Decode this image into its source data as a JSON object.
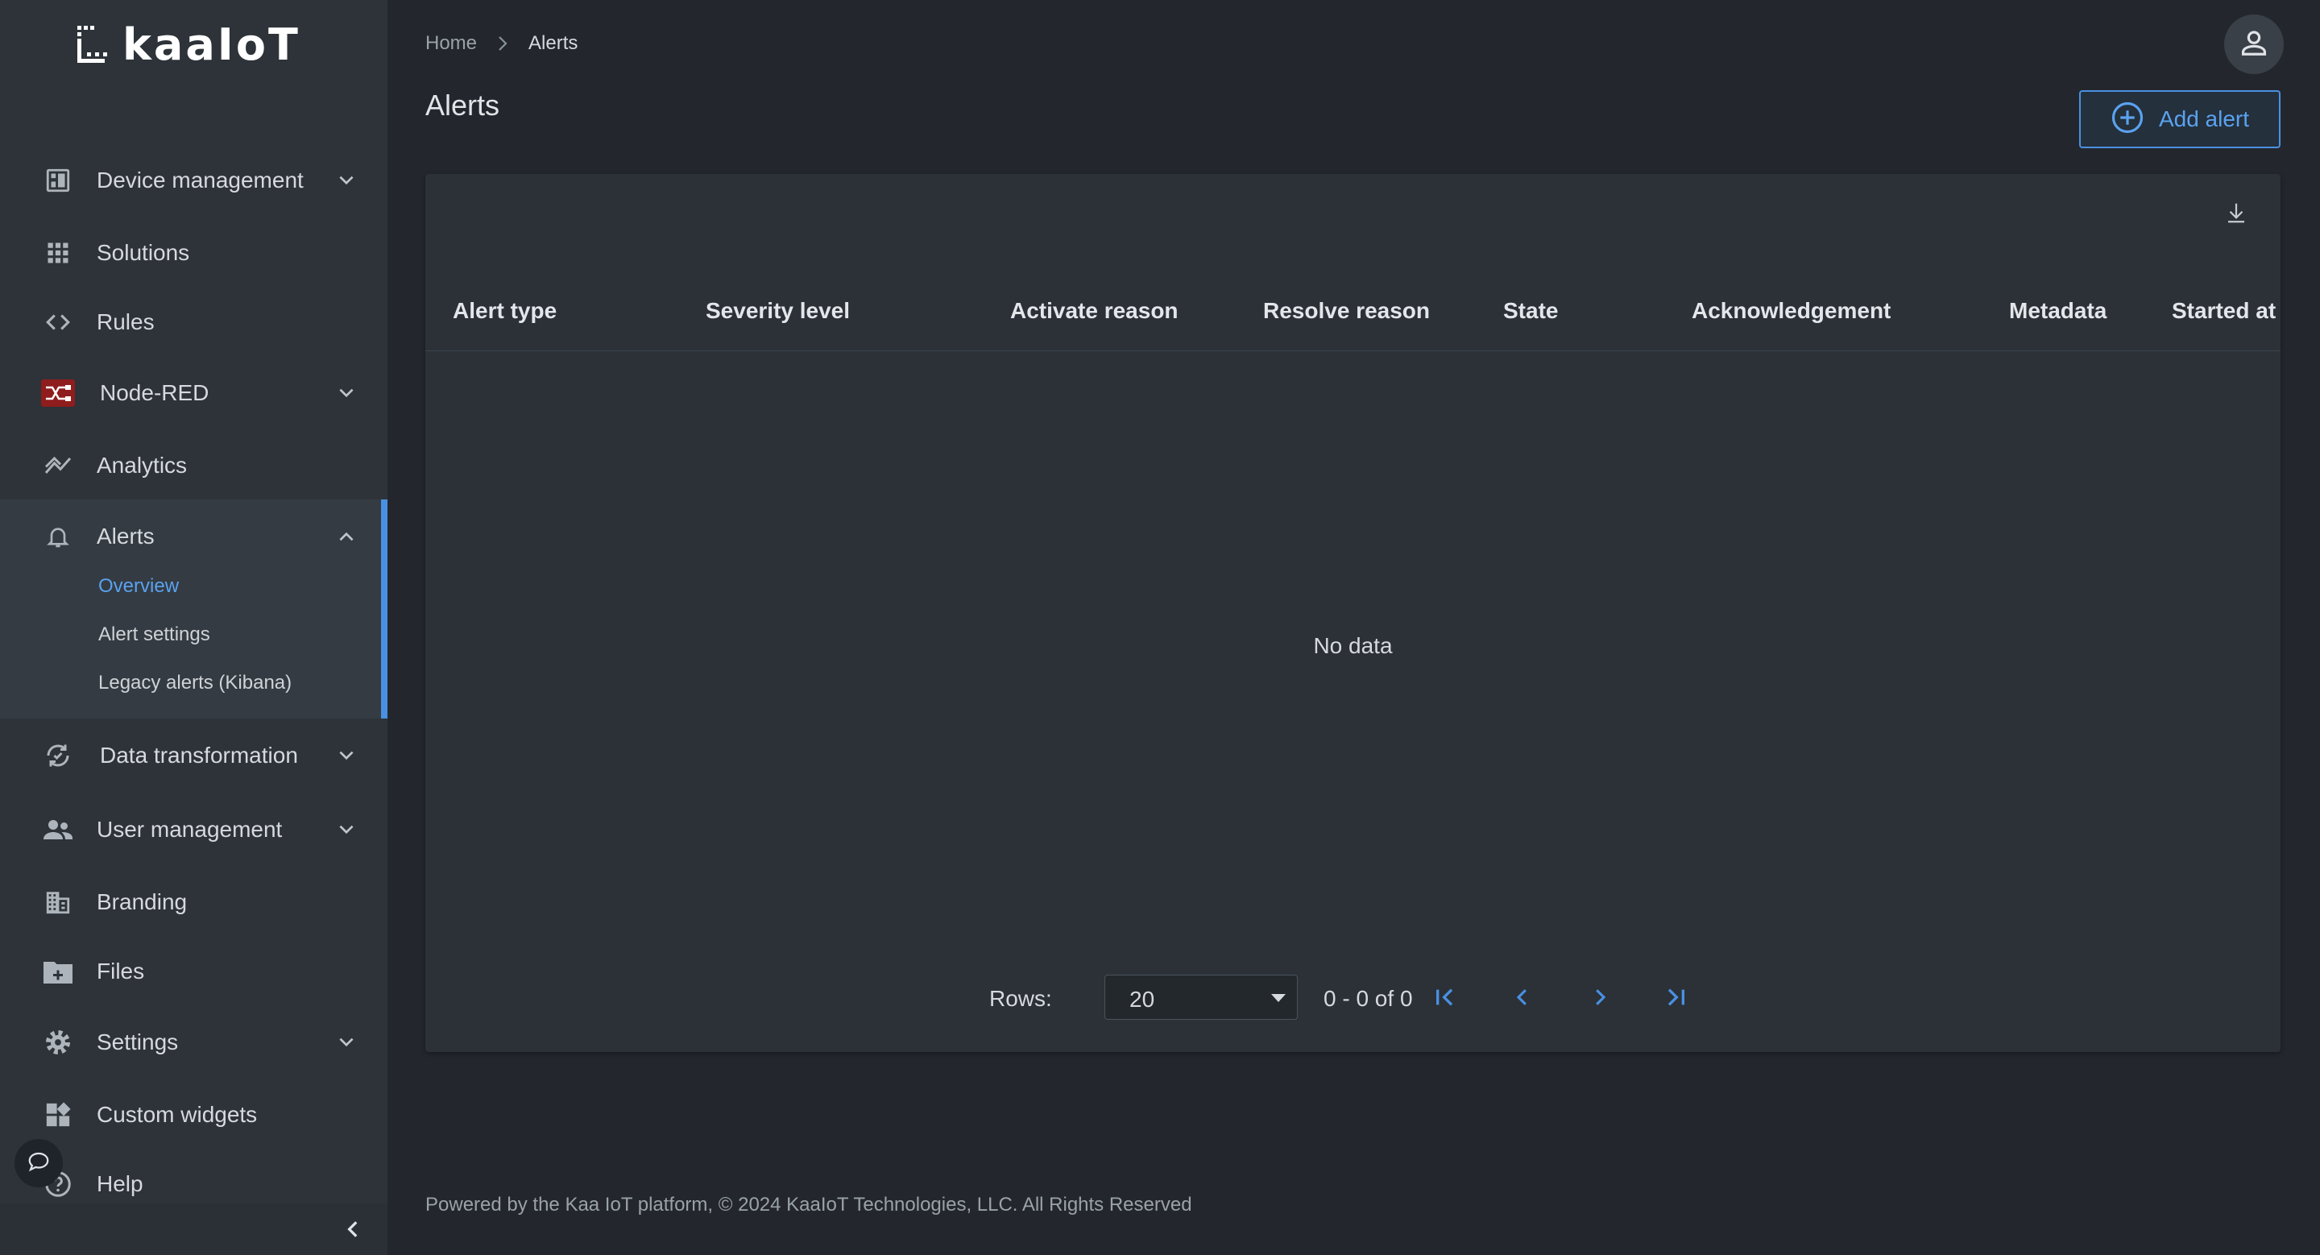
{
  "brand": {
    "logo_text": "kaaIoT"
  },
  "sidebar": {
    "items": [
      {
        "label": "Device management",
        "icon": "dashboard-icon",
        "expandable": true
      },
      {
        "label": "Solutions",
        "icon": "apps-grid-icon"
      },
      {
        "label": "Rules",
        "icon": "code-icon"
      },
      {
        "label": "Node-RED",
        "icon": "node-red-icon",
        "expandable": true
      },
      {
        "label": "Analytics",
        "icon": "analytics-icon"
      },
      {
        "label": "Alerts",
        "icon": "bell-icon",
        "expanded": true
      },
      {
        "label": "Data transformation",
        "icon": "sync-icon",
        "expandable": true
      },
      {
        "label": "User management",
        "icon": "users-icon",
        "expandable": true
      },
      {
        "label": "Branding",
        "icon": "building-icon"
      },
      {
        "label": "Files",
        "icon": "folder-icon"
      },
      {
        "label": "Settings",
        "icon": "gear-icon",
        "expandable": true
      },
      {
        "label": "Custom widgets",
        "icon": "widgets-icon"
      },
      {
        "label": "Help",
        "icon": "help-icon"
      }
    ],
    "alerts_sub": [
      {
        "label": "Overview",
        "active": true
      },
      {
        "label": "Alert settings"
      },
      {
        "label": "Legacy alerts (Kibana)"
      }
    ]
  },
  "breadcrumb": {
    "home": "Home",
    "current": "Alerts"
  },
  "page": {
    "title": "Alerts"
  },
  "toolbar": {
    "add_label": "Add alert"
  },
  "table": {
    "columns": [
      "Alert type",
      "Severity level",
      "Activate reason",
      "Resolve reason",
      "State",
      "Acknowledgement",
      "Metadata",
      "Started at"
    ],
    "empty_text": "No data"
  },
  "pagination": {
    "rows_label": "Rows:",
    "rows_value": "20",
    "range_text": "0 - 0 of 0"
  },
  "footer": {
    "text": "Powered by the Kaa IoT platform, © 2024 KaaIoT Technologies, LLC. All Rights Reserved"
  },
  "colors": {
    "accent": "#4a90e2",
    "sidebar_bg": "#2d3339",
    "main_bg": "#23272d",
    "card_bg": "#2b3137"
  }
}
